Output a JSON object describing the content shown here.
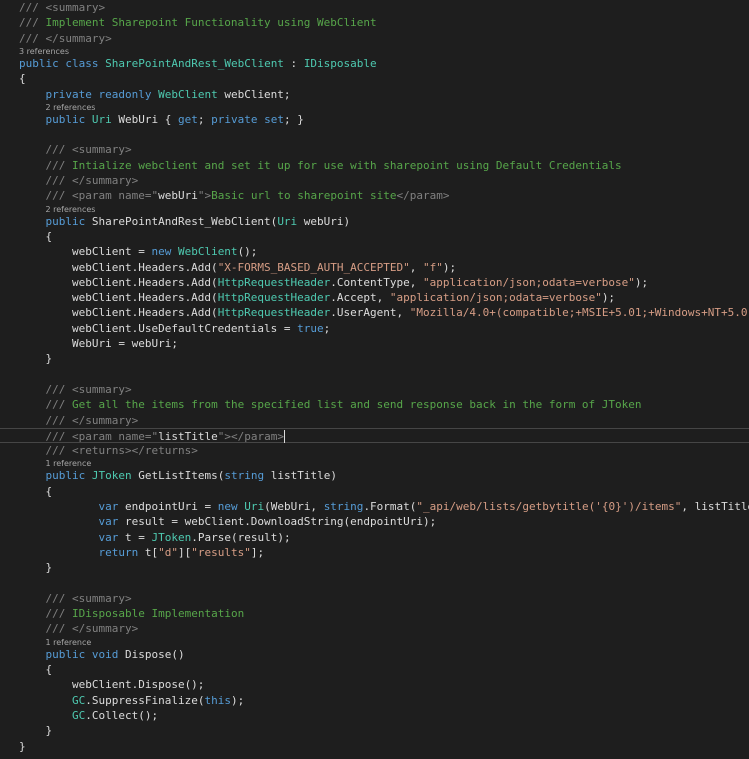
{
  "editor": {
    "background": "#1e1e1e",
    "colors": {
      "keyword": "#569cd6",
      "type": "#4ec9b0",
      "string": "#d69d85",
      "comment": "#57a64a",
      "xml_doc_tag": "#808080",
      "plain": "#dcdcdc",
      "code_lens": "#a6a6a6"
    },
    "current_line": 26,
    "lines": [
      [
        [
          "dg",
          "/// "
        ],
        [
          "dg",
          "<summary>"
        ]
      ],
      [
        [
          "dg",
          "/// "
        ],
        [
          "cm",
          "Implement Sharepoint Functionality using WebClient"
        ]
      ],
      [
        [
          "dg",
          "/// "
        ],
        [
          "dg",
          "</summary>"
        ]
      ],
      [
        [
          "kw",
          "public"
        ],
        [
          "pl",
          " "
        ],
        [
          "kw",
          "class"
        ],
        [
          "pl",
          " "
        ],
        [
          "ty",
          "SharePointAndRest_WebClient"
        ],
        [
          "pl",
          " : "
        ],
        [
          "ty",
          "IDisposable"
        ]
      ],
      [
        [
          "pl",
          "{"
        ]
      ],
      [
        [
          "pl",
          "    "
        ],
        [
          "kw",
          "private"
        ],
        [
          "pl",
          " "
        ],
        [
          "kw",
          "readonly"
        ],
        [
          "pl",
          " "
        ],
        [
          "ty",
          "WebClient"
        ],
        [
          "pl",
          " webClient;"
        ]
      ],
      [
        [
          "pl",
          "    "
        ],
        [
          "kw",
          "public"
        ],
        [
          "pl",
          " "
        ],
        [
          "ty",
          "Uri"
        ],
        [
          "pl",
          " WebUri { "
        ],
        [
          "kw",
          "get"
        ],
        [
          "pl",
          "; "
        ],
        [
          "kw",
          "private"
        ],
        [
          "pl",
          " "
        ],
        [
          "kw",
          "set"
        ],
        [
          "pl",
          "; }"
        ]
      ],
      [],
      [
        [
          "pl",
          "    "
        ],
        [
          "dg",
          "/// "
        ],
        [
          "dg",
          "<summary>"
        ]
      ],
      [
        [
          "pl",
          "    "
        ],
        [
          "dg",
          "/// "
        ],
        [
          "cm",
          "Intialize webclient and set it up for use with sharepoint using Default Credentials"
        ]
      ],
      [
        [
          "pl",
          "    "
        ],
        [
          "dg",
          "/// "
        ],
        [
          "dg",
          "</summary>"
        ]
      ],
      [
        [
          "pl",
          "    "
        ],
        [
          "dg",
          "/// "
        ],
        [
          "dg",
          "<param "
        ],
        [
          "dg",
          "name"
        ],
        [
          "dg",
          "=\""
        ],
        [
          "pl",
          "webUri"
        ],
        [
          "dg",
          "\">"
        ],
        [
          "cm",
          "Basic url to sharepoint site"
        ],
        [
          "dg",
          "</param>"
        ]
      ],
      [
        [
          "pl",
          "    "
        ],
        [
          "kw",
          "public"
        ],
        [
          "pl",
          " SharePointAndRest_WebClient("
        ],
        [
          "ty",
          "Uri"
        ],
        [
          "pl",
          " webUri)"
        ]
      ],
      [
        [
          "pl",
          "    {"
        ]
      ],
      [
        [
          "pl",
          "        webClient = "
        ],
        [
          "kw",
          "new"
        ],
        [
          "pl",
          " "
        ],
        [
          "ty",
          "WebClient"
        ],
        [
          "pl",
          "();"
        ]
      ],
      [
        [
          "pl",
          "        webClient.Headers.Add("
        ],
        [
          "st",
          "\"X-FORMS_BASED_AUTH_ACCEPTED\""
        ],
        [
          "pl",
          ", "
        ],
        [
          "st",
          "\"f\""
        ],
        [
          "pl",
          ");"
        ]
      ],
      [
        [
          "pl",
          "        webClient.Headers.Add("
        ],
        [
          "ty",
          "HttpRequestHeader"
        ],
        [
          "pl",
          ".ContentType, "
        ],
        [
          "st",
          "\"application/json;odata=verbose\""
        ],
        [
          "pl",
          ");"
        ]
      ],
      [
        [
          "pl",
          "        webClient.Headers.Add("
        ],
        [
          "ty",
          "HttpRequestHeader"
        ],
        [
          "pl",
          ".Accept, "
        ],
        [
          "st",
          "\"application/json;odata=verbose\""
        ],
        [
          "pl",
          ");"
        ]
      ],
      [
        [
          "pl",
          "        webClient.Headers.Add("
        ],
        [
          "ty",
          "HttpRequestHeader"
        ],
        [
          "pl",
          ".UserAgent, "
        ],
        [
          "st",
          "\"Mozilla/4.0+(compatible;+MSIE+5.01;+Windows+NT+5.0\""
        ],
        [
          "pl",
          ");"
        ]
      ],
      [
        [
          "pl",
          "        webClient.UseDefaultCredentials = "
        ],
        [
          "kw",
          "true"
        ],
        [
          "pl",
          ";"
        ]
      ],
      [
        [
          "pl",
          "        WebUri = webUri;"
        ]
      ],
      [
        [
          "pl",
          "    }"
        ]
      ],
      [],
      [
        [
          "pl",
          "    "
        ],
        [
          "dg",
          "/// "
        ],
        [
          "dg",
          "<summary>"
        ]
      ],
      [
        [
          "pl",
          "    "
        ],
        [
          "dg",
          "/// "
        ],
        [
          "cm",
          "Get all the items from the specified list and send response back in the form of JToken"
        ]
      ],
      [
        [
          "pl",
          "    "
        ],
        [
          "dg",
          "/// "
        ],
        [
          "dg",
          "</summary>"
        ]
      ],
      [
        [
          "pl",
          "    "
        ],
        [
          "dg",
          "/// "
        ],
        [
          "dg",
          "<param "
        ],
        [
          "dg",
          "name"
        ],
        [
          "dg",
          "=\""
        ],
        [
          "pl",
          "listTitle"
        ],
        [
          "dg",
          "\">"
        ],
        [
          "dg",
          "</param>"
        ]
      ],
      [
        [
          "pl",
          "    "
        ],
        [
          "dg",
          "/// "
        ],
        [
          "dg",
          "<returns>"
        ],
        [
          "dg",
          "</returns>"
        ]
      ],
      [
        [
          "pl",
          "    "
        ],
        [
          "kw",
          "public"
        ],
        [
          "pl",
          " "
        ],
        [
          "ty",
          "JToken"
        ],
        [
          "pl",
          " GetListItems("
        ],
        [
          "kw",
          "string"
        ],
        [
          "pl",
          " listTitle)"
        ]
      ],
      [
        [
          "pl",
          "    {"
        ]
      ],
      [
        [
          "pl",
          "            "
        ],
        [
          "kw",
          "var"
        ],
        [
          "pl",
          " endpointUri = "
        ],
        [
          "kw",
          "new"
        ],
        [
          "pl",
          " "
        ],
        [
          "ty",
          "Uri"
        ],
        [
          "pl",
          "(WebUri, "
        ],
        [
          "kw",
          "string"
        ],
        [
          "pl",
          ".Format("
        ],
        [
          "st",
          "\"_api/web/lists/getbytitle('{0}')/items\""
        ],
        [
          "pl",
          ", listTitle));"
        ]
      ],
      [
        [
          "pl",
          "            "
        ],
        [
          "kw",
          "var"
        ],
        [
          "pl",
          " result = webClient.DownloadString(endpointUri);"
        ]
      ],
      [
        [
          "pl",
          "            "
        ],
        [
          "kw",
          "var"
        ],
        [
          "pl",
          " t = "
        ],
        [
          "ty",
          "JToken"
        ],
        [
          "pl",
          ".Parse(result);"
        ]
      ],
      [
        [
          "pl",
          "            "
        ],
        [
          "kw",
          "return"
        ],
        [
          "pl",
          " t["
        ],
        [
          "st",
          "\"d\""
        ],
        [
          "pl",
          "]["
        ],
        [
          "st",
          "\"results\""
        ],
        [
          "pl",
          "];"
        ]
      ],
      [
        [
          "pl",
          "    }"
        ]
      ],
      [],
      [
        [
          "pl",
          "    "
        ],
        [
          "dg",
          "/// "
        ],
        [
          "dg",
          "<summary>"
        ]
      ],
      [
        [
          "pl",
          "    "
        ],
        [
          "dg",
          "/// "
        ],
        [
          "cm",
          "IDisposable Implementation"
        ]
      ],
      [
        [
          "pl",
          "    "
        ],
        [
          "dg",
          "/// "
        ],
        [
          "dg",
          "</summary>"
        ]
      ],
      [
        [
          "pl",
          "    "
        ],
        [
          "kw",
          "public"
        ],
        [
          "pl",
          " "
        ],
        [
          "kw",
          "void"
        ],
        [
          "pl",
          " Dispose()"
        ]
      ],
      [
        [
          "pl",
          "    {"
        ]
      ],
      [
        [
          "pl",
          "        webClient.Dispose();"
        ]
      ],
      [
        [
          "pl",
          "        "
        ],
        [
          "ty",
          "GC"
        ],
        [
          "pl",
          ".SuppressFinalize("
        ],
        [
          "kw",
          "this"
        ],
        [
          "pl",
          ");"
        ]
      ],
      [
        [
          "pl",
          "        "
        ],
        [
          "ty",
          "GC"
        ],
        [
          "pl",
          ".Collect();"
        ]
      ],
      [
        [
          "pl",
          "    }"
        ]
      ],
      [
        [
          "pl",
          "}"
        ]
      ]
    ],
    "code_lens": [
      {
        "text": "3 references",
        "before_line": 3
      },
      {
        "text": "2 references",
        "before_line": 6
      },
      {
        "text": "2 references",
        "before_line": 12
      },
      {
        "text": "1 reference",
        "before_line": 28
      },
      {
        "text": "1 reference",
        "before_line": 39
      }
    ]
  }
}
